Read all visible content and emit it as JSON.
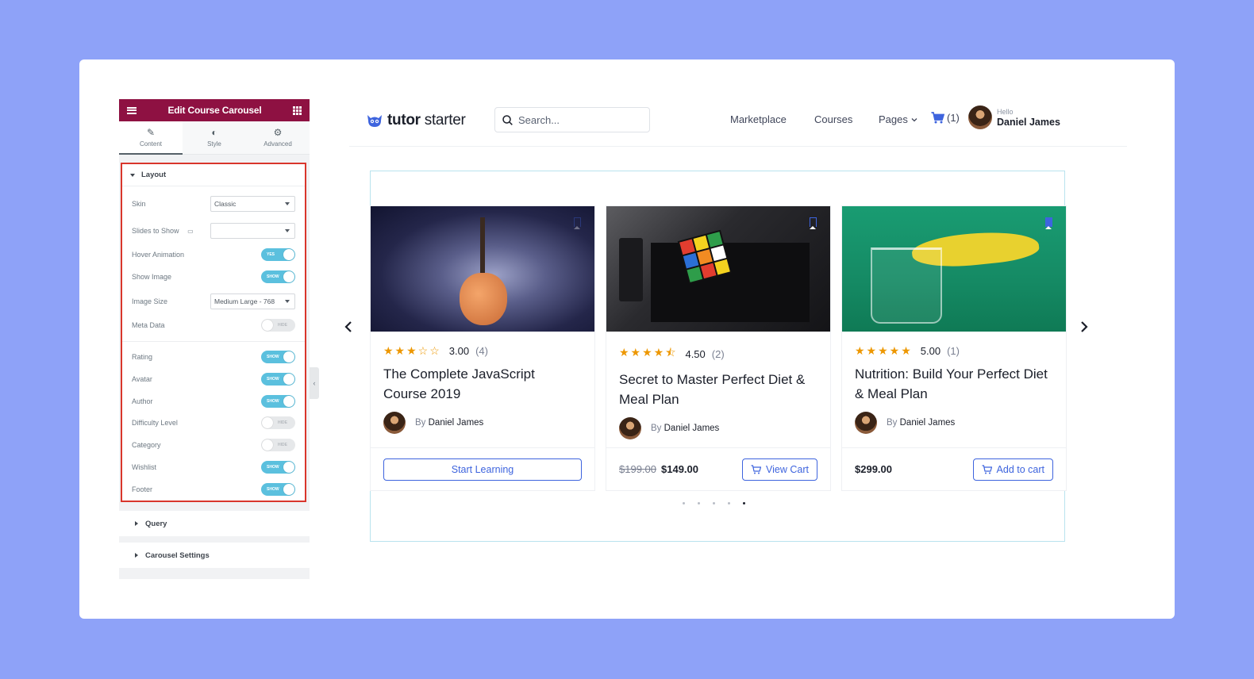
{
  "editor": {
    "title": "Edit Course Carousel",
    "tabs": [
      {
        "label": "Content",
        "icon": "pencil-icon",
        "active": true
      },
      {
        "label": "Style",
        "icon": "half-circle-icon",
        "active": false
      },
      {
        "label": "Advanced",
        "icon": "gear-icon",
        "active": false
      }
    ],
    "layout_section": "Layout",
    "skin": {
      "label": "Skin",
      "value": "Classic"
    },
    "slides_to_show": {
      "label": "Slides to Show",
      "value": ""
    },
    "hover_animation": {
      "label": "Hover Animation",
      "state": "YES"
    },
    "show_image": {
      "label": "Show Image",
      "state": "SHOW"
    },
    "image_size": {
      "label": "Image Size",
      "value": "Medium Large - 768"
    },
    "meta_data": {
      "label": "Meta Data",
      "state": "HIDE"
    },
    "rating": {
      "label": "Rating",
      "state": "SHOW"
    },
    "avatar": {
      "label": "Avatar",
      "state": "SHOW"
    },
    "author": {
      "label": "Author",
      "state": "SHOW"
    },
    "difficulty_level": {
      "label": "Difficulty Level",
      "state": "HIDE"
    },
    "category": {
      "label": "Category",
      "state": "HIDE"
    },
    "wishlist": {
      "label": "Wishlist",
      "state": "SHOW"
    },
    "footer": {
      "label": "Footer",
      "state": "SHOW"
    },
    "query_section": "Query",
    "carousel_section": "Carousel Settings"
  },
  "site": {
    "logo_bold": "tutor",
    "logo_light": " starter",
    "search_placeholder": "Search...",
    "nav": {
      "marketplace": "Marketplace",
      "courses": "Courses",
      "pages": "Pages"
    },
    "cart_count": "(1)",
    "hello": "Hello",
    "user_name": "Daniel James"
  },
  "courses": [
    {
      "rating": "3.00",
      "count": "(4)",
      "stars": "★★★☆☆",
      "title": "The Complete JavaScript Course 2019",
      "by": "By",
      "author": "Daniel James",
      "button": "Start Learning",
      "old_price": "",
      "price": ""
    },
    {
      "rating": "4.50",
      "count": "(2)",
      "stars": "★★★★⯪",
      "title": "Secret to Master Perfect Diet & Meal Plan",
      "by": "By",
      "author": "Daniel James",
      "button": "View Cart",
      "old_price": "$199.00",
      "price": "$149.00"
    },
    {
      "rating": "5.00",
      "count": "(1)",
      "stars": "★★★★★",
      "title": "Nutrition: Build Your Perfect Diet & Meal Plan",
      "by": "By",
      "author": "Daniel James",
      "button": "Add to cart",
      "old_price": "",
      "price": "$299.00"
    }
  ],
  "colors": {
    "accent": "#3e64de",
    "editor_header": "#8e1142",
    "toggle_on": "#5bc0de",
    "star": "#ed9700",
    "highlight": "#d9362c"
  }
}
